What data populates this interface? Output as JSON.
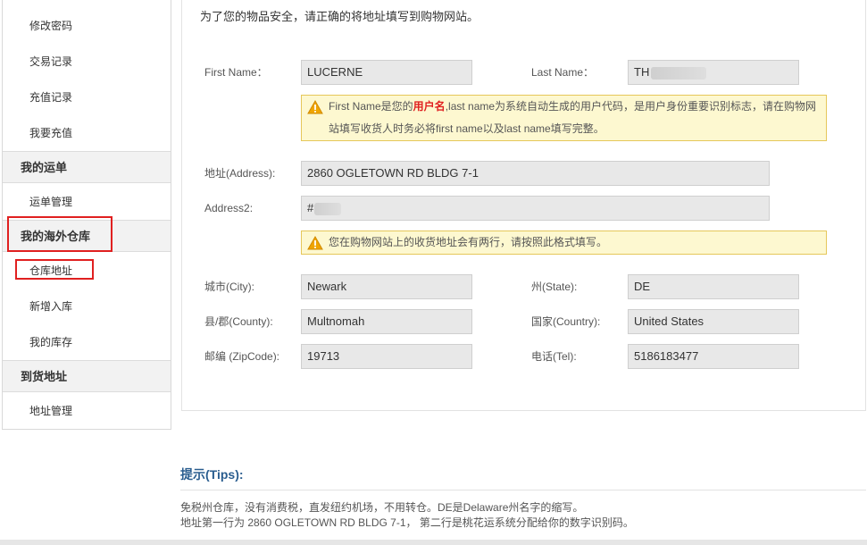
{
  "sidebar": {
    "items": [
      {
        "label": "修改密码"
      },
      {
        "label": "交易记录"
      },
      {
        "label": "充值记录"
      },
      {
        "label": "我要充值"
      }
    ],
    "sections": [
      {
        "title": "我的运单",
        "items": [
          {
            "label": "运单管理"
          }
        ]
      },
      {
        "title": "我的海外仓库",
        "items": [
          {
            "label": "仓库地址"
          },
          {
            "label": "新增入库"
          },
          {
            "label": "我的库存"
          }
        ]
      },
      {
        "title": "到货地址",
        "items": [
          {
            "label": "地址管理"
          }
        ]
      }
    ]
  },
  "form": {
    "intro": "为了您的物品安全，请正确的将地址填写到购物网站。",
    "first_name": {
      "label": "First Name：",
      "value": "LUCERNE"
    },
    "last_name": {
      "label": "Last Name：",
      "value": "TH"
    },
    "warning1": {
      "pre": "First Name是您的",
      "highlight": "用户名",
      "post": ",last name为系统自动生成的用户代码，是用户身份重要识别标志，请在购物网站填写收货人时务必将first name以及last name填写完整。"
    },
    "address": {
      "label": "地址(Address):",
      "value": "2860 OGLETOWN RD BLDG 7-1"
    },
    "address2": {
      "label": "Address2:",
      "value": "#"
    },
    "warning2": "您在购物网站上的收货地址会有两行，请按照此格式填写。",
    "city": {
      "label": "城市(City):",
      "value": "Newark"
    },
    "state": {
      "label": "州(State):",
      "value": "DE"
    },
    "county": {
      "label": "县/郡(County):",
      "value": "Multnomah"
    },
    "country": {
      "label": "国家(Country):",
      "value": "United States"
    },
    "zip": {
      "label": "邮编 (ZipCode):",
      "value": "19713"
    },
    "tel": {
      "label": "电话(Tel):",
      "value": "5186183477"
    }
  },
  "tips": {
    "title": "提示(Tips):",
    "line1": "免税州仓库，没有消费税，直发纽约机场，不用转仓。DE是Delaware州名字的缩写。",
    "line2": "地址第一行为 2860 OGLETOWN RD BLDG 7-1， 第二行是桃花运系统分配给你的数字识别码。"
  },
  "colors": {
    "highlight_red": "#e02020",
    "warning_bg": "#fdf8d0",
    "tips_title": "#2a5d8f"
  }
}
